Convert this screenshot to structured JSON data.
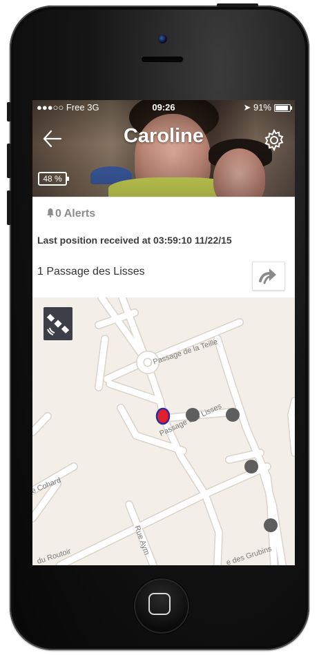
{
  "status_bar": {
    "carrier": "●●●○○ Free  3G",
    "time": "09:26",
    "battery": "91%",
    "battery_level": 0.91
  },
  "header": {
    "title": "Caroline",
    "back_icon": "back-arrow-icon",
    "settings_icon": "gear-icon",
    "device_battery": "48 %",
    "device_battery_level": 0.48
  },
  "info": {
    "alerts": "0 Alerts",
    "alerts_icon": "bell-icon",
    "last_position": "Last position received at 03:59:10 11/22/15",
    "address": "1 Passage des Lisses",
    "directions_icon": "directions-arrow-icon"
  },
  "map": {
    "layer_icon": "satellite-icon",
    "streets": {
      "teille": "Passage de la Teille",
      "lisses": "Passage des Lisses",
      "cohard": "e Cohard",
      "routoir": "du Routoir",
      "aymon": "Rue Aym",
      "grubins": "e des Grubins"
    },
    "colors": {
      "current_position_fill": "#e0202a",
      "current_position_stroke": "#2a2aa8",
      "history_point": "#5e5e5e",
      "road": "#ffffff",
      "road_edge": "#d8d3cb"
    }
  }
}
